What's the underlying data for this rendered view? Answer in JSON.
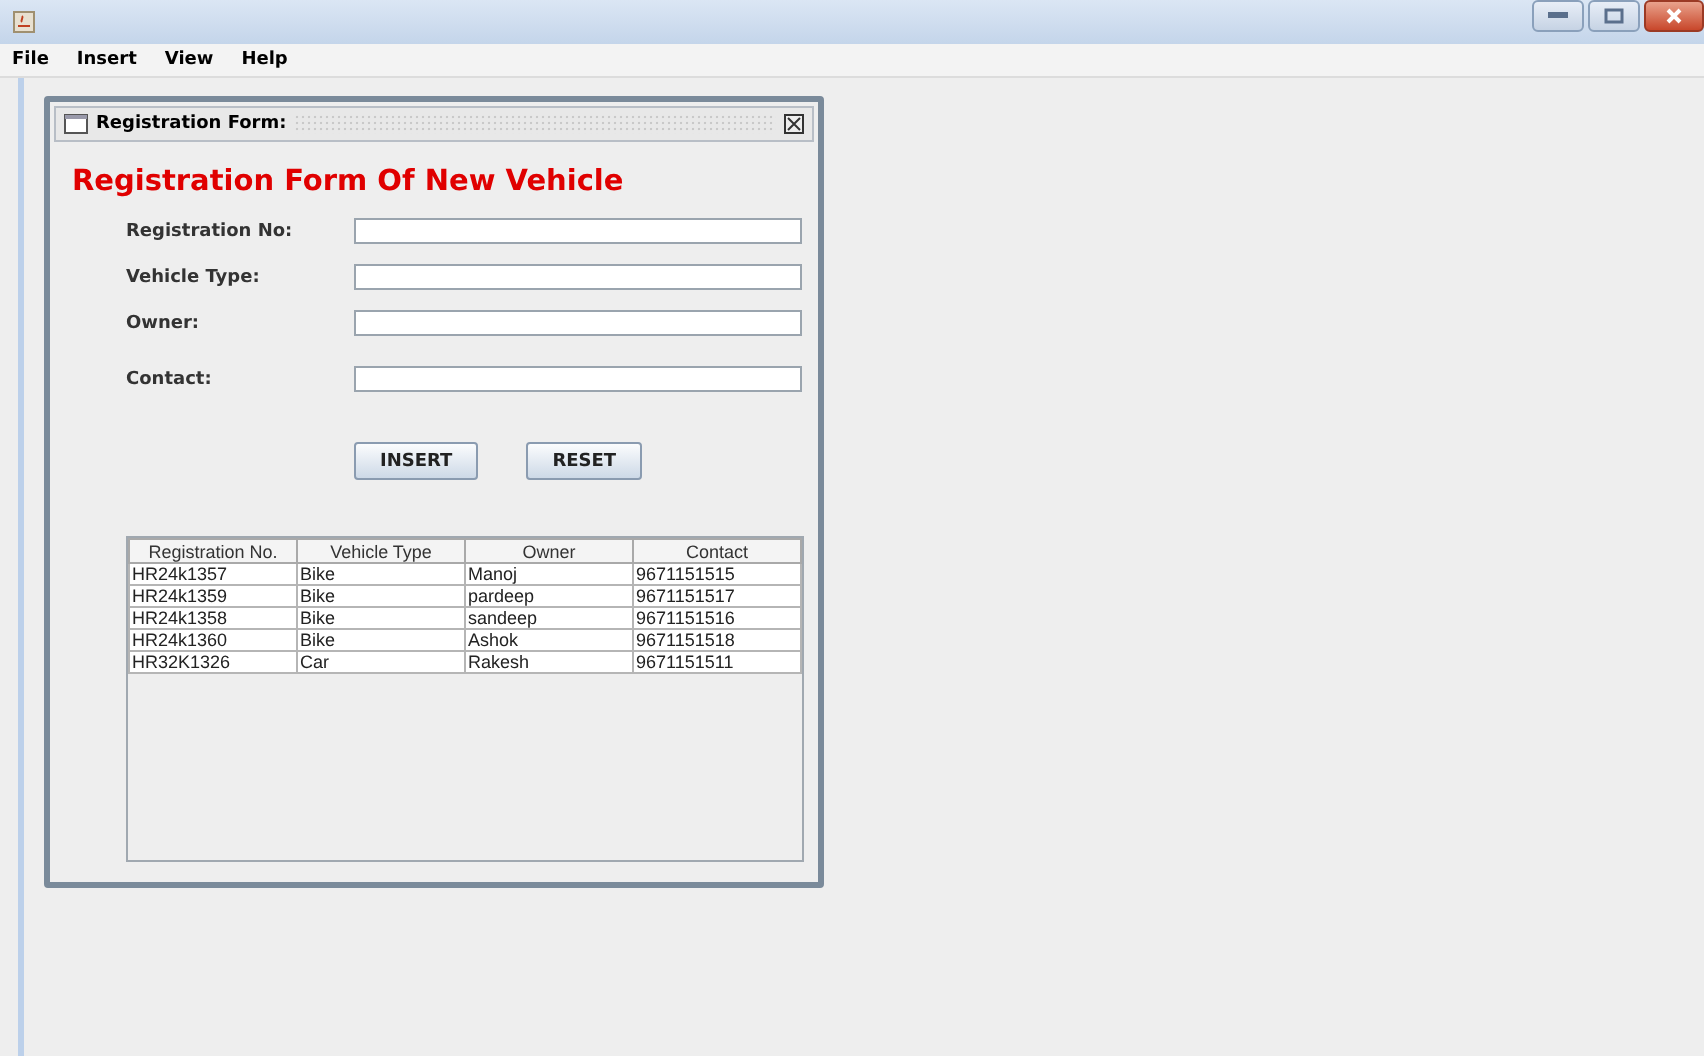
{
  "menu": [
    "File",
    "Insert",
    "View",
    "Help"
  ],
  "frame": {
    "title": "Registration Form:",
    "heading": "Registration Form Of New Vehicle",
    "fields": [
      {
        "label": "Registration No:"
      },
      {
        "label": "Vehicle Type:"
      },
      {
        "label": "Owner:"
      },
      {
        "label": "Contact:"
      }
    ],
    "buttons": [
      "INSERT",
      "RESET"
    ],
    "table": {
      "columns": [
        "Registration No.",
        "Vehicle Type",
        "Owner",
        "Contact"
      ],
      "rows": [
        [
          "HR24k1357",
          "Bike",
          "Manoj",
          "9671151515"
        ],
        [
          "HR24k1359",
          "Bike",
          "pardeep",
          "9671151517"
        ],
        [
          "HR24k1358",
          "Bike",
          "sandeep",
          "9671151516"
        ],
        [
          "HR24k1360",
          "Bike",
          "Ashok",
          "9671151518"
        ],
        [
          "HR32K1326",
          "Car",
          "Rakesh",
          "9671151511"
        ]
      ]
    }
  }
}
